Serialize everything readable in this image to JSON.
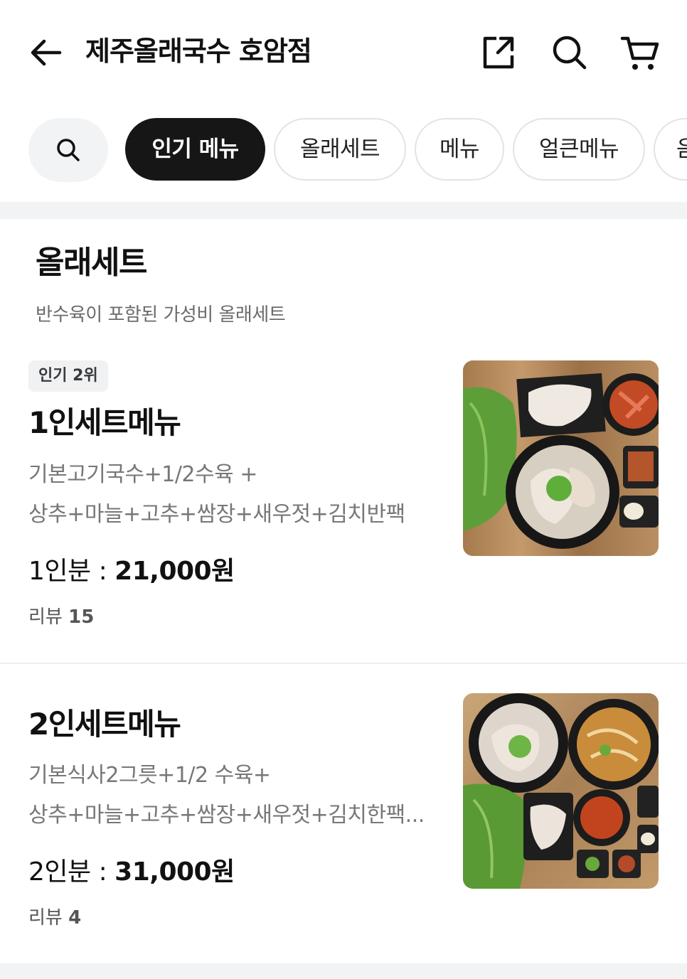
{
  "header": {
    "title": "제주올래국수 호암점",
    "icons": [
      "arrow-left-icon",
      "share-icon",
      "search-icon",
      "cart-icon"
    ]
  },
  "chips": {
    "search_icon": "search-icon",
    "items": [
      {
        "label": "인기 메뉴",
        "active": true
      },
      {
        "label": "올래세트",
        "active": false
      },
      {
        "label": "메뉴",
        "active": false
      },
      {
        "label": "얼큰메뉴",
        "active": false
      },
      {
        "label": "음",
        "active": false
      }
    ]
  },
  "section": {
    "title": "올래세트",
    "subtitle": "반수육이 포함된 가성비 올래세트"
  },
  "items": [
    {
      "badge": "인기 2위",
      "name": "1인세트메뉴",
      "desc_line1": "기본고기국수+1/2수육 +",
      "desc_line2": "상추+마늘+고추+쌈장+새우젓+김치반팩",
      "price_prefix": "1인분 : ",
      "price": "21,000원",
      "review_label": "리뷰",
      "review_count": "15"
    },
    {
      "badge": "",
      "name": "2인세트메뉴",
      "desc_line1": "기본식사2그릇+1/2 수육+",
      "desc_line2": "상추+마늘+고추+쌈장+새우젓+김치한팩...",
      "price_prefix": "2인분 : ",
      "price": "31,000원",
      "review_label": "리뷰",
      "review_count": "4"
    }
  ],
  "colors": {
    "active_chip": "#161616",
    "band": "#f2f3f5",
    "muted_text": "#777777"
  }
}
